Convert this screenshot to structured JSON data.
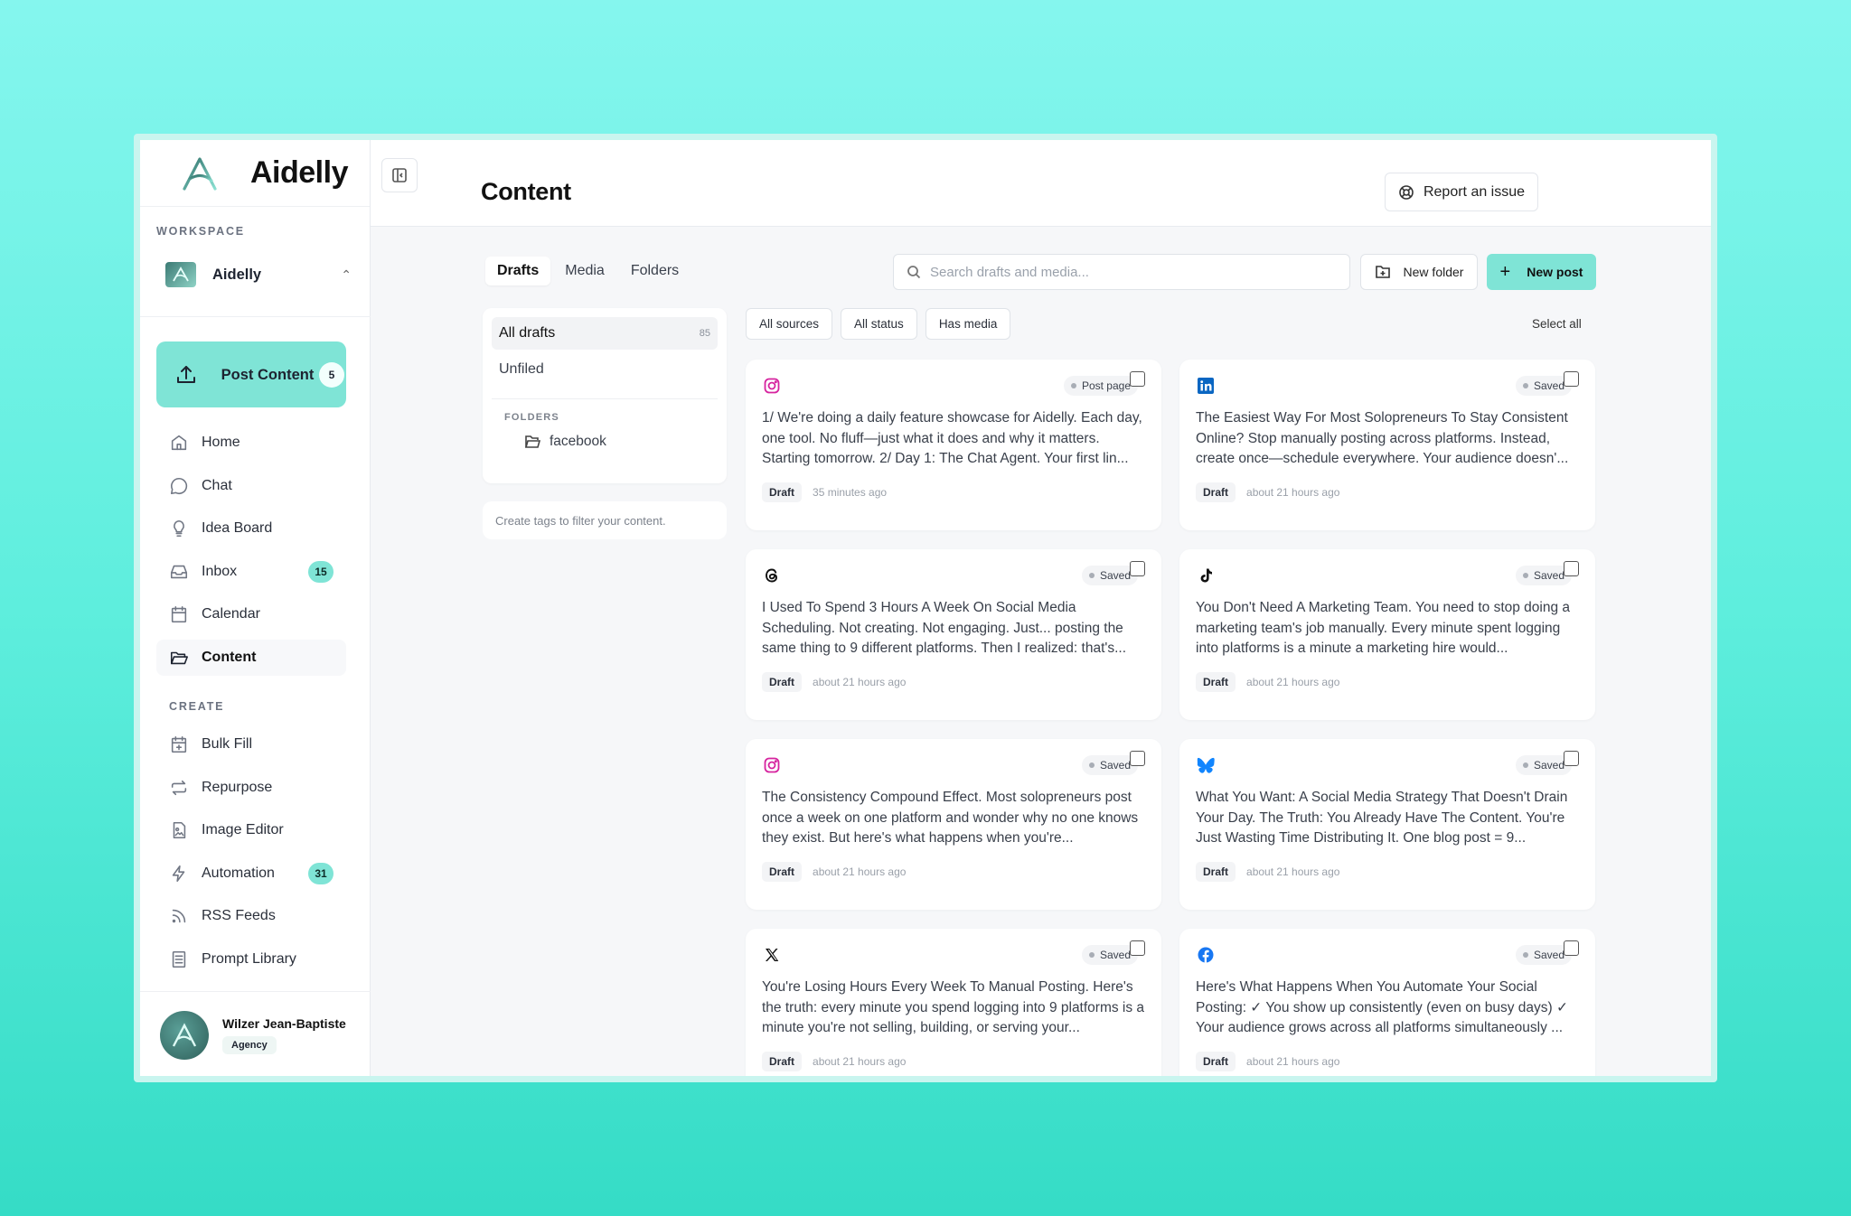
{
  "app": {
    "brand": "Aidelly"
  },
  "sidebar": {
    "workspace_label": "WORKSPACE",
    "workspace_name": "Aidelly",
    "post_button": {
      "label": "Post Content",
      "count": "5"
    },
    "nav": [
      {
        "label": "Home",
        "icon": "home-icon"
      },
      {
        "label": "Chat",
        "icon": "chat-icon"
      },
      {
        "label": "Idea Board",
        "icon": "lightbulb-icon"
      },
      {
        "label": "Inbox",
        "icon": "inbox-icon",
        "badge": "15"
      },
      {
        "label": "Calendar",
        "icon": "calendar-icon"
      },
      {
        "label": "Content",
        "icon": "folder-icon",
        "active": true
      }
    ],
    "create_label": "CREATE",
    "create": [
      {
        "label": "Bulk Fill",
        "icon": "calendar-plus-icon"
      },
      {
        "label": "Repurpose",
        "icon": "repeat-icon"
      },
      {
        "label": "Image Editor",
        "icon": "image-file-icon"
      },
      {
        "label": "Automation",
        "icon": "bolt-icon",
        "badge": "31"
      },
      {
        "label": "RSS Feeds",
        "icon": "rss-icon"
      },
      {
        "label": "Prompt Library",
        "icon": "library-icon"
      }
    ],
    "user": {
      "name": "Wilzer Jean-Baptiste",
      "plan": "Agency"
    }
  },
  "header": {
    "title": "Content",
    "report_label": "Report an issue"
  },
  "tabs": [
    "Drafts",
    "Media",
    "Folders"
  ],
  "search": {
    "placeholder": "Search drafts and media..."
  },
  "actions": {
    "new_folder": "New folder",
    "new_post": "New post"
  },
  "drafts_panel": {
    "all_drafts": "All drafts",
    "all_count": "85",
    "unfiled": "Unfiled",
    "folders_label": "FOLDERS",
    "folders": [
      "facebook"
    ]
  },
  "tags_hint": "Create tags to filter your content.",
  "filters": [
    "All sources",
    "All status",
    "Has media"
  ],
  "select_all": "Select all",
  "colors": {
    "accent": "#7fe4d6",
    "instagram": "#d6249f",
    "linkedin": "#0a66c2",
    "bluesky": "#1185fe",
    "facebook": "#1877f2"
  },
  "cards": [
    {
      "platform": "instagram-icon",
      "status": "Post page",
      "text": "1/ We're doing a daily feature showcase for Aidelly. Each day, one tool. No fluff—just what it does and why it matters. Starting tomorrow. 2/ Day 1: The Chat Agent. Your first lin...",
      "tag": "Draft",
      "time": "35 minutes ago"
    },
    {
      "platform": "linkedin-icon",
      "status": "Saved",
      "text": "The Easiest Way For Most Solopreneurs To Stay Consistent Online? Stop manually posting across platforms. Instead, create once—schedule everywhere. Your audience doesn'...",
      "tag": "Draft",
      "time": "about 21 hours ago"
    },
    {
      "platform": "threads-icon",
      "status": "Saved",
      "text": "I Used To Spend 3 Hours A Week On Social Media Scheduling. Not creating. Not engaging. Just... posting the same thing to 9 different platforms. Then I realized: that's...",
      "tag": "Draft",
      "time": "about 21 hours ago"
    },
    {
      "platform": "tiktok-icon",
      "status": "Saved",
      "text": "You Don't Need A Marketing Team. You need to stop doing a marketing team's job manually. Every minute spent logging into platforms is a minute a marketing hire would...",
      "tag": "Draft",
      "time": "about 21 hours ago"
    },
    {
      "platform": "instagram-icon",
      "status": "Saved",
      "text": "The Consistency Compound Effect. Most solopreneurs post once a week on one platform and wonder why no one knows they exist. But here's what happens when you're...",
      "tag": "Draft",
      "time": "about 21 hours ago"
    },
    {
      "platform": "bluesky-icon",
      "status": "Saved",
      "text": "What You Want: A Social Media Strategy That Doesn't Drain Your Day. The Truth: You Already Have The Content. You're Just Wasting Time Distributing It. One blog post = 9...",
      "tag": "Draft",
      "time": "about 21 hours ago"
    },
    {
      "platform": "x-icon",
      "status": "Saved",
      "text": "You're Losing Hours Every Week To Manual Posting. Here's the truth: every minute you spend logging into 9 platforms is a minute you're not selling, building, or serving your...",
      "tag": "Draft",
      "time": "about 21 hours ago"
    },
    {
      "platform": "facebook-icon",
      "status": "Saved",
      "text": "Here's What Happens When You Automate Your Social Posting: ✓ You show up consistently (even on busy days) ✓ Your audience grows across all platforms simultaneously ...",
      "tag": "Draft",
      "time": "about 21 hours ago"
    }
  ]
}
